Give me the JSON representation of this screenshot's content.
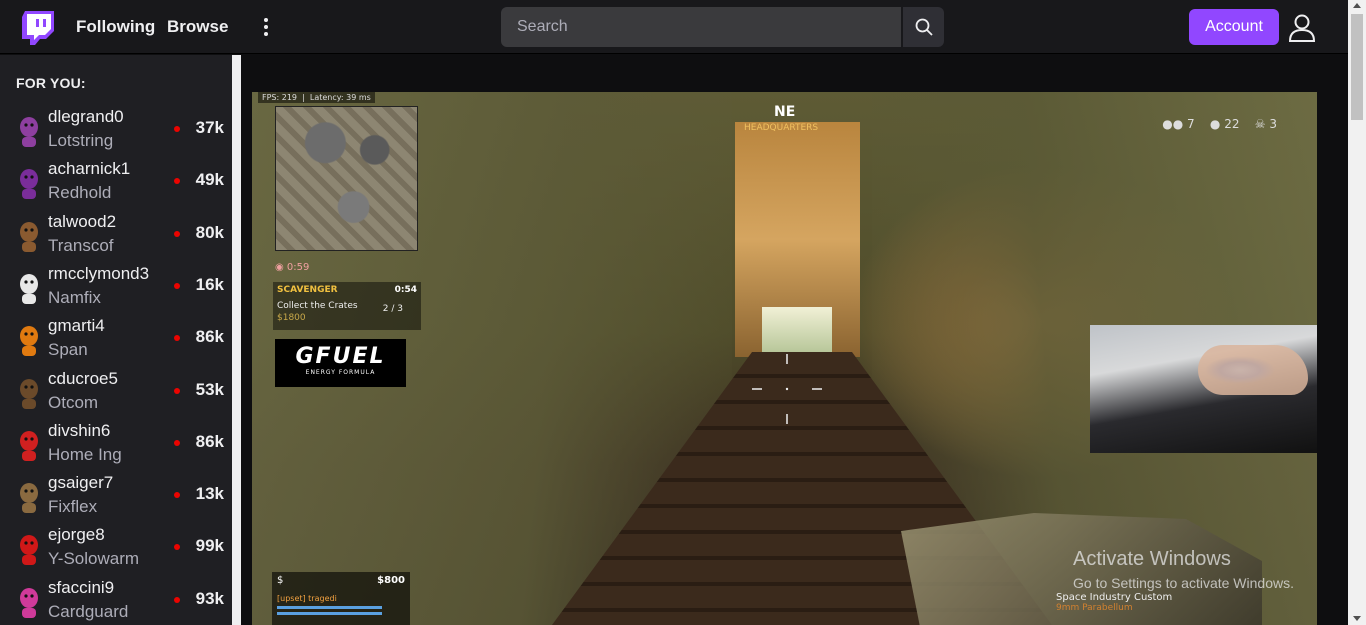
{
  "nav": {
    "following_label": "Following",
    "browse_label": "Browse",
    "search_placeholder": "Search",
    "account_label": "Account"
  },
  "sidebar": {
    "section_title": "FOR YOU:",
    "channels": [
      {
        "name": "dlegrand0",
        "game": "Lotstring",
        "viewers": "37k",
        "avatar_color": "#8e3fa0"
      },
      {
        "name": "acharnick1",
        "game": "Redhold",
        "viewers": "49k",
        "avatar_color": "#7a2d9a"
      },
      {
        "name": "talwood2",
        "game": "Transcof",
        "viewers": "80k",
        "avatar_color": "#8a5a30"
      },
      {
        "name": "rmcclymond3",
        "game": "Namfix",
        "viewers": "16k",
        "avatar_color": "#e8e8e8"
      },
      {
        "name": "gmarti4",
        "game": "Span",
        "viewers": "86k",
        "avatar_color": "#e07a10"
      },
      {
        "name": "cducroe5",
        "game": "Otcom",
        "viewers": "53k",
        "avatar_color": "#6b4a2a"
      },
      {
        "name": "divshin6",
        "game": "Home Ing",
        "viewers": "86k",
        "avatar_color": "#d02020"
      },
      {
        "name": "gsaiger7",
        "game": "Fixflex",
        "viewers": "13k",
        "avatar_color": "#8a6a40"
      },
      {
        "name": "ejorge8",
        "game": "Y-Solowarm",
        "viewers": "99k",
        "avatar_color": "#d01818"
      },
      {
        "name": "sfaccini9",
        "game": "Cardguard",
        "viewers": "93k",
        "avatar_color": "#d03a9a"
      }
    ]
  },
  "player": {
    "hud_fps": "FPS: 219",
    "hud_latency": "Latency: 39 ms",
    "compass_heading": "NE",
    "compass_location": "HEADQUARTERS",
    "squad_count": "7",
    "players_count": "22",
    "kills_count": "3",
    "timer": "0:59",
    "contract_title": "SCAVENGER",
    "contract_time": "0:54",
    "contract_task": "Collect the Crates",
    "contract_progress": "2 / 3",
    "contract_reward": "$1800",
    "sponsor_name": "GFUEL",
    "sponsor_tagline": "ENERGY FORMULA",
    "money_symbol": "$",
    "money_value": "$800",
    "team_label": "[upset] tragedi",
    "weapon_name": "Space Industry Custom",
    "ammo_type": "9mm Parabellum",
    "activate_title": "Activate Windows",
    "activate_sub": "Go to Settings to activate Windows."
  },
  "colors": {
    "accent": "#9147ff",
    "live": "#eb0400",
    "nav_bg": "#18181b",
    "sidebar_bg": "#1f1f23"
  }
}
